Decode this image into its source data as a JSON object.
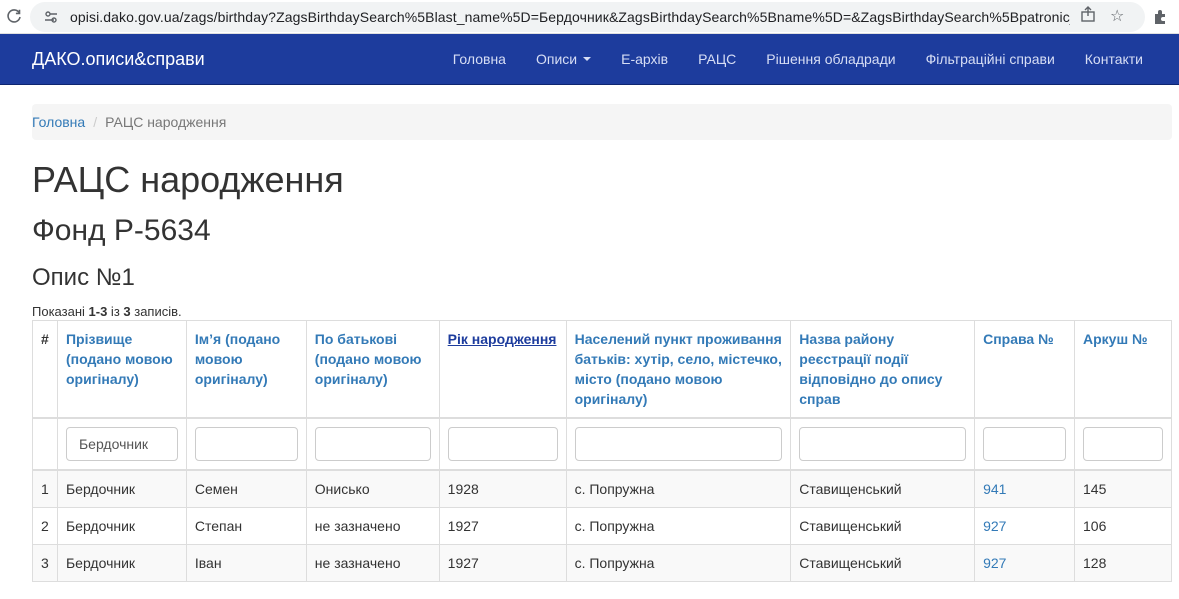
{
  "browser": {
    "url": "opisi.dako.gov.ua/zags/birthday?ZagsBirthdaySearch%5Blast_name%5D=Бердочник&ZagsBirthdaySearch%5Bname%5D=&ZagsBirthdaySearch%5Bpatronic_nam..."
  },
  "navbar": {
    "brand": "ДАКО.описи&справи",
    "items": [
      "Головна",
      "Описи",
      "Е-архів",
      "РАЦС",
      "Рішення обладради",
      "Фільтраційні справи",
      "Контакти"
    ]
  },
  "breadcrumb": {
    "home": "Головна",
    "separator": "/",
    "current": "РАЦС народження"
  },
  "page": {
    "title": "РАЦС народження",
    "fond": "Фонд Р-5634",
    "opys": "Опис №1"
  },
  "summary": {
    "prefix": "Показані ",
    "range": "1-3",
    "mid": " із ",
    "total": "3",
    "suffix": " записів."
  },
  "table": {
    "headers": [
      "#",
      "Прізвище (подано мовою оригіналу)",
      "Ім’я (подано мовою оригіналу)",
      "По батькові (подано мовою оригіналу)",
      "Рік народження",
      "Населений пункт проживання батьків: хутір, село, містечко, місто (подано мовою оригіналу)",
      "Назва району реєстрації події відповідно до опису справ",
      "Справа №",
      "Аркуш №"
    ],
    "filters": {
      "last_name": "Бердочник",
      "name": "",
      "patronic": "",
      "year": "",
      "place": "",
      "district": "",
      "case": "",
      "sheet": ""
    },
    "rows": [
      [
        "1",
        "Бердочник",
        "Семен",
        "Онисько",
        "1928",
        "с. Попружна",
        "Ставищенський",
        "941",
        "145"
      ],
      [
        "2",
        "Бердочник",
        "Степан",
        "не зазначено",
        "1927",
        "с. Попружна",
        "Ставищенський",
        "927",
        "106"
      ],
      [
        "3",
        "Бердочник",
        "Іван",
        "не зазначено",
        "1927",
        "с. Попружна",
        "Ставищенський",
        "927",
        "128"
      ]
    ]
  }
}
